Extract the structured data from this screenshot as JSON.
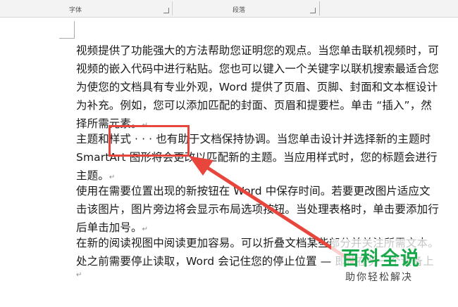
{
  "ribbon": {
    "font_group": "字体",
    "paragraph_group": "段落"
  },
  "document": {
    "lines": [
      "视频提供了功能强大的方法帮助您证明您的观点。当您单击联机视频时，可",
      "视频的嵌入代码中进行粘贴。您也可以键入一个关键字以联机搜索最适合您",
      "为使您的文档具有专业外观，Word 提供了页眉、页脚、封面和文本框设计",
      "为补充。例如，您可以添加匹配的封面、页眉和提要栏。单击 “插入”，然",
      "择所需元素。",
      "主题和样式 · · · 也有助于文档保持协调。当您单击设计并选择新的主题时",
      "SmartArt 图形将会更改以匹配新的主题。当应用样式时，您的标题会进行",
      "主题。",
      "使用在需要位置出现的新按钮在 Word 中保存时间。若要更改图片适应文",
      "击该图片，图片旁边将会显示布局选项按钮。当处理表格时，单击要添加行",
      "后单击加号。",
      "在新的阅读视图中阅读更加容易。可以折叠文档某些部分并关注所需文本。",
      "处之前需要停止读取，Word 会记住您的停止位置 — 即使在另一个设备上"
    ],
    "paragraph_mark": "↵"
  },
  "annotation": {
    "box_color": "#e8453c",
    "arrow_color": "#e8453c"
  },
  "watermark": {
    "title": "百科全说",
    "subtitle": "助你轻松解决",
    "color": "#19a84a"
  }
}
